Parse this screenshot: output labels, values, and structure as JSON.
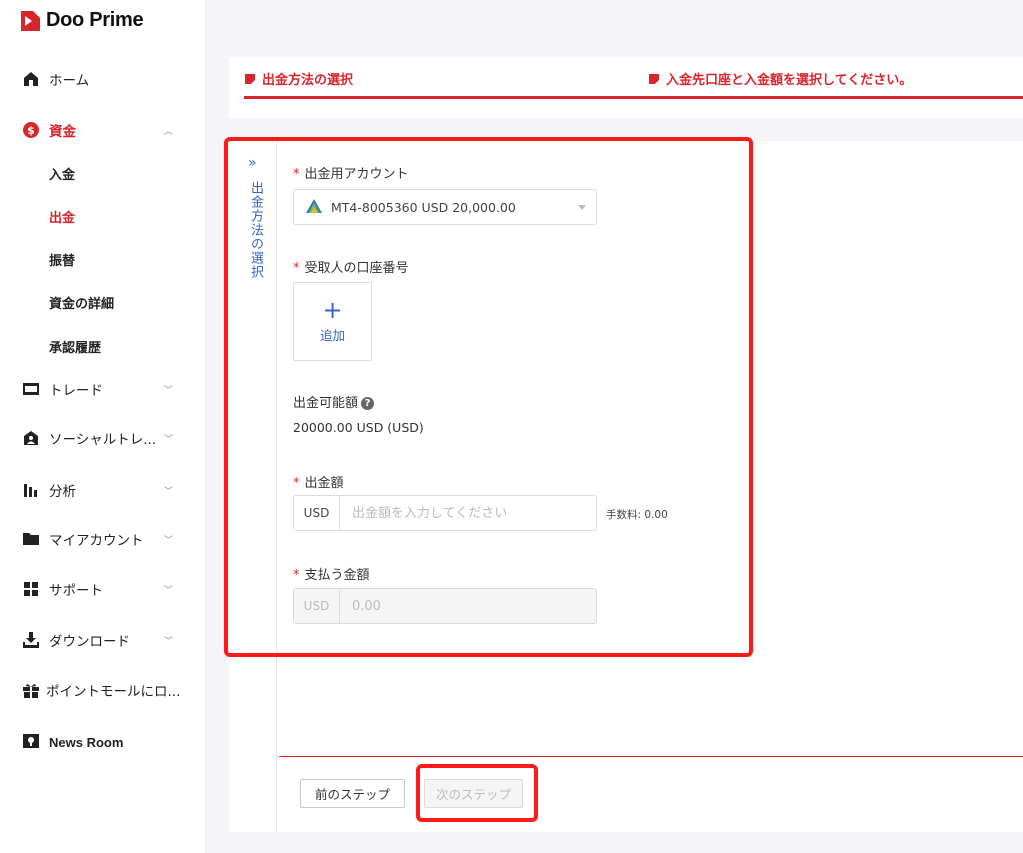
{
  "brand": {
    "name": "Doo Prime",
    "color": "#d9262c"
  },
  "sidebar": {
    "items": [
      {
        "label": "ホーム",
        "icon": "home-icon"
      },
      {
        "label": "資金",
        "icon": "dollar-circle-icon",
        "active": true
      },
      {
        "label": "トレード",
        "icon": "card-icon"
      },
      {
        "label": "ソーシャルトレ...",
        "icon": "social-user-icon"
      },
      {
        "label": "分析",
        "icon": "bar-chart-icon"
      },
      {
        "label": "マイアカウント",
        "icon": "folder-icon"
      },
      {
        "label": "サポート",
        "icon": "grid-icon"
      },
      {
        "label": "ダウンロード",
        "icon": "download-icon"
      },
      {
        "label": "ポイントモールにロ...",
        "icon": "gift-icon"
      },
      {
        "label": "News Room",
        "icon": "news-icon"
      }
    ],
    "funds_sub": [
      {
        "label": "入金"
      },
      {
        "label": "出金",
        "active": true
      },
      {
        "label": "振替"
      },
      {
        "label": "資金の詳細"
      },
      {
        "label": "承認履歴"
      }
    ]
  },
  "steps": {
    "step1": "出金方法の選択",
    "step2": "入金先口座と入金額を選択してください。"
  },
  "vertical_tab": {
    "label": "出金方法の選択"
  },
  "form": {
    "account_label": "出金用アカウント",
    "account_value": "MT4-8005360 USD 20,000.00",
    "receiver_label": "受取人の口座番号",
    "add_label": "追加",
    "available_label": "出金可能額",
    "available_value": "20000.00 USD (USD)",
    "amount_label": "出金額",
    "amount_currency": "USD",
    "amount_placeholder": "出金額を入力してください",
    "fee_text": "手数料: 0.00",
    "pay_label": "支払う金額",
    "pay_currency": "USD",
    "pay_value": "0.00"
  },
  "buttons": {
    "prev": "前のステップ",
    "next": "次のステップ"
  }
}
